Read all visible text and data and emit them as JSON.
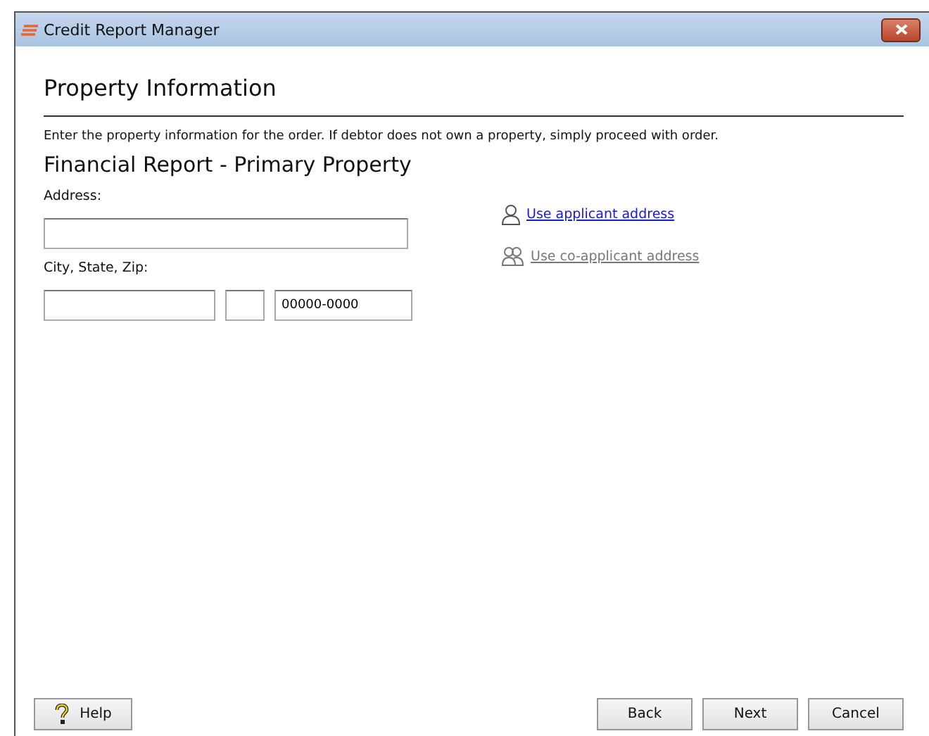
{
  "window": {
    "title": "Credit Report Manager"
  },
  "page_title": "Property Information",
  "instructions": "Enter the property information for the order. If debtor does not own a property, simply proceed with order.",
  "section_title": "Financial Report - Primary Property",
  "address": {
    "label": "Address:"
  },
  "city_state_zip": {
    "label": "City, State, Zip:",
    "zip": "00000-0000"
  },
  "links": [
    {
      "kind": "single",
      "label": "Use applicant address",
      "disabled": false
    },
    {
      "kind": "pair",
      "label": "Use co-applicant address",
      "disabled": true
    }
  ],
  "buttons": [
    {
      "kind": "help",
      "label": "Help"
    },
    {
      "kind": "plain",
      "label": "Back"
    },
    {
      "kind": "plain",
      "label": "Next"
    },
    {
      "kind": "plain",
      "label": "Cancel"
    }
  ]
}
